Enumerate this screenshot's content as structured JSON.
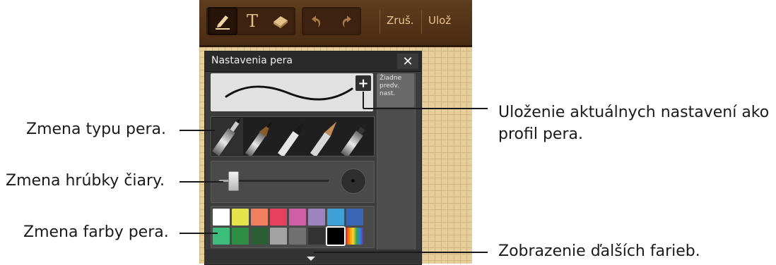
{
  "toolbar": {
    "text_tool_glyph": "T",
    "cancel_label": "Zruš.",
    "save_label": "Ulož"
  },
  "panel": {
    "title": "Nastavenia pera",
    "close_glyph": "✕",
    "add_preset_glyph": "+",
    "presets_empty": "Žiadne\npredv.\nnast."
  },
  "callouts": {
    "save_profile_line1": "Uloženie aktuálnych nastavení ako",
    "save_profile_line2": "profil pera.",
    "pen_type": "Zmena typu pera.",
    "line_thickness": "Zmena hrúbky čiary.",
    "pen_color": "Zmena farby pera.",
    "more_colors": "Zobrazenie ďalších farieb."
  },
  "thickness_level": 0.12,
  "colors": {
    "row1": [
      "#ffffff",
      "#e6e24a",
      "#f07f5e",
      "#e6405f",
      "#cd5fa6",
      "#9c84c0",
      "#3fa0d8",
      "#3a67b3"
    ],
    "row2": [
      "#3dbd7a",
      "#2e8f44",
      "#2a5f36",
      "#a3a3a3",
      "#707070",
      "#333333",
      "#000000",
      "rainbow"
    ],
    "selected": "#000000"
  },
  "icons": [
    "pen-icon",
    "text-icon",
    "eraser-icon",
    "undo-icon",
    "redo-icon",
    "close-icon",
    "plus-icon",
    "chevron-down-icon"
  ]
}
